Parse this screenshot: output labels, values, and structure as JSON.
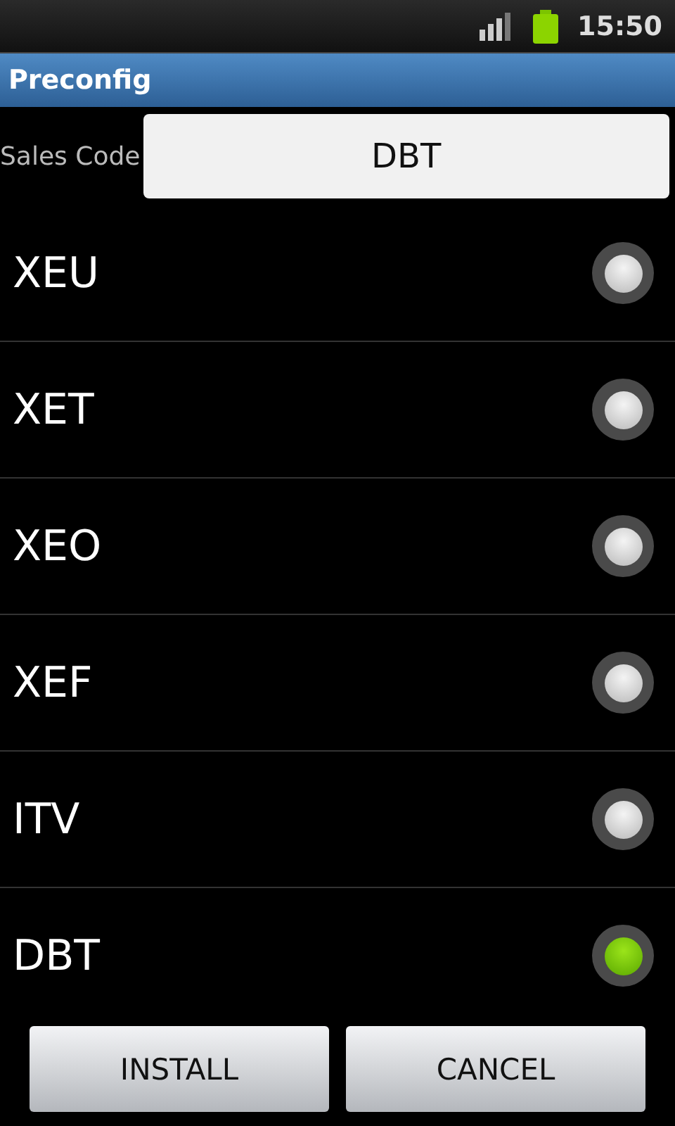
{
  "status_bar": {
    "time": "15:50"
  },
  "window": {
    "title": "Preconfig"
  },
  "sales_code": {
    "label": "Sales Code",
    "value": "DBT"
  },
  "options": [
    {
      "label": "XEU",
      "selected": false
    },
    {
      "label": "XET",
      "selected": false
    },
    {
      "label": "XEO",
      "selected": false
    },
    {
      "label": "XEF",
      "selected": false
    },
    {
      "label": "ITV",
      "selected": false
    },
    {
      "label": "DBT",
      "selected": true
    }
  ],
  "buttons": [
    "INSTALL",
    "CANCEL"
  ]
}
